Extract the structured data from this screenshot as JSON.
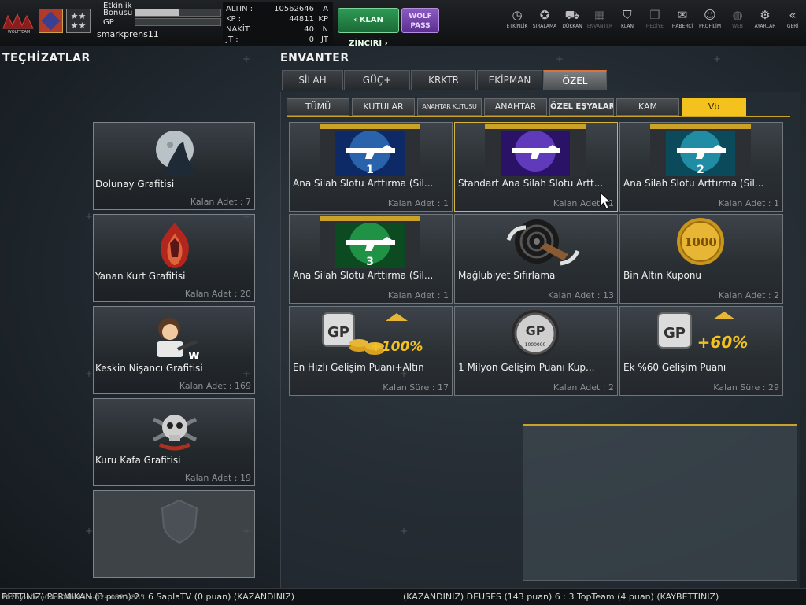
{
  "player": {
    "event_bonus_label": "Etkinlik Bonusu",
    "event_bonus_progress": 0.52,
    "gp_label": "GP",
    "gp_progress": 0.0,
    "username": "smarkprens11",
    "logo_text": "WOLFTEAM",
    "rank_stars": "★★\n★★"
  },
  "currency": [
    {
      "label": "ALTIN :",
      "value": "10562646",
      "unit": "A"
    },
    {
      "label": "KP :",
      "value": "44811",
      "unit": "KP"
    },
    {
      "label": "NAKİT:",
      "value": "40",
      "unit": "N"
    },
    {
      "label": "JT :",
      "value": "0",
      "unit": "JT"
    }
  ],
  "buttons": {
    "klan_chain": "KLAN ZİNCİRİ",
    "wolf_pass": "WOLF PASS"
  },
  "nav": [
    {
      "label": "ETKİNLİK",
      "icon": "timer-icon",
      "glyph": "◷"
    },
    {
      "label": "SIRALAMA",
      "icon": "medal-icon",
      "glyph": "✪"
    },
    {
      "label": "DÜKKAN",
      "icon": "cart-icon",
      "glyph": "⛟"
    },
    {
      "label": "ENVANTER",
      "icon": "inventory-icon",
      "glyph": "▦"
    },
    {
      "label": "KLAN",
      "icon": "clan-shield-icon",
      "glyph": "⛉"
    },
    {
      "label": "HEDİYE",
      "icon": "gift-icon",
      "glyph": "❒"
    },
    {
      "label": "HABERCİ",
      "icon": "megaphone-icon",
      "glyph": "✉"
    },
    {
      "label": "PROFİLİM",
      "icon": "profile-icon",
      "glyph": "☺"
    },
    {
      "label": "WEB",
      "icon": "globe-icon",
      "glyph": "◍"
    },
    {
      "label": "AYARLAR",
      "icon": "gear-icon",
      "glyph": "⚙"
    },
    {
      "label": "GERİ",
      "icon": "back-icon",
      "glyph": "«"
    }
  ],
  "left": {
    "title": "TEÇHİZATLAR",
    "cards": [
      {
        "name": "Dolunay Grafitisi",
        "count": "Kalan Adet : 7",
        "icon": "full-moon-wolf-icon"
      },
      {
        "name": "Yanan Kurt Grafitisi",
        "count": "Kalan Adet : 20",
        "icon": "burning-wolf-icon"
      },
      {
        "name": "Keskin Nişancı Grafitisi",
        "count": "Kalan Adet : 169",
        "icon": "sniper-girl-icon"
      },
      {
        "name": "Kuru Kafa Grafitisi",
        "count": "Kalan Adet : 19",
        "icon": "skull-icon"
      }
    ]
  },
  "inventory": {
    "title": "ENVANTER",
    "tabs": [
      "SİLAH",
      "GÜÇ+",
      "KRKTR",
      "EKİPMAN",
      "ÖZEL"
    ],
    "active_tab": "ÖZEL",
    "subtabs": [
      "TÜMÜ",
      "KUTULAR",
      "ANAHTAR KUTUSU",
      "ANAHTAR",
      "ÖZEL EŞYALAR",
      "KAM",
      "Vb"
    ],
    "active_subtab": "Vb",
    "items": [
      {
        "name": "Ana Silah Slotu Arttırma (Sil...",
        "count": "Kalan Adet : 1",
        "badge": "1",
        "glow": "#4aa8ff"
      },
      {
        "name": "Standart Ana Silah Slotu Artt...",
        "count": "Kalan Adet : 1",
        "badge": "",
        "glow": "#8a5bff"
      },
      {
        "name": "Ana Silah Slotu Arttırma (Sil...",
        "count": "Kalan Adet : 1",
        "badge": "2",
        "glow": "#3fe0ff"
      },
      {
        "name": "Ana Silah Slotu Arttırma (Sil...",
        "count": "Kalan Adet : 1",
        "badge": "3",
        "glow": "#3fff7a"
      },
      {
        "name": "Mağlubiyet  Sıfırlama",
        "count": "Kalan Adet : 13",
        "badge": "",
        "glow": ""
      },
      {
        "name": "Bin Altın Kuponu",
        "count": "Kalan Adet : 2",
        "badge": "1000",
        "glow": ""
      },
      {
        "name": "En Hızlı Gelişim Puanı+Altın",
        "count": "Kalan Süre : 17",
        "badge": "+100%",
        "glow": ""
      },
      {
        "name": "1 Milyon Gelişim Puanı Kup...",
        "count": "Kalan Adet : 2",
        "badge": "1000000",
        "glow": ""
      },
      {
        "name": "Ek %60 Gelişim Puanı",
        "count": "Kalan Süre : 29",
        "badge": "+60%",
        "glow": ""
      }
    ]
  },
  "ticker": {
    "left": "BETTINIZ) PERMIKAN (3 puan) 2 : 6 SaplaTV (0 puan) (KAZANDINIZ)",
    "right": "(KAZANDINIZ) DEUSES (143 puan) 6 : 3 TopTeam (4 puan) (KAYBETTINIZ)",
    "timestamp": "2025y-10m-04d-06h-45m-02s-0321-885"
  },
  "colors": {
    "accent": "#f3c21d",
    "klan_green": "#2e9a55",
    "wolf_purple": "#8a5bc0"
  }
}
